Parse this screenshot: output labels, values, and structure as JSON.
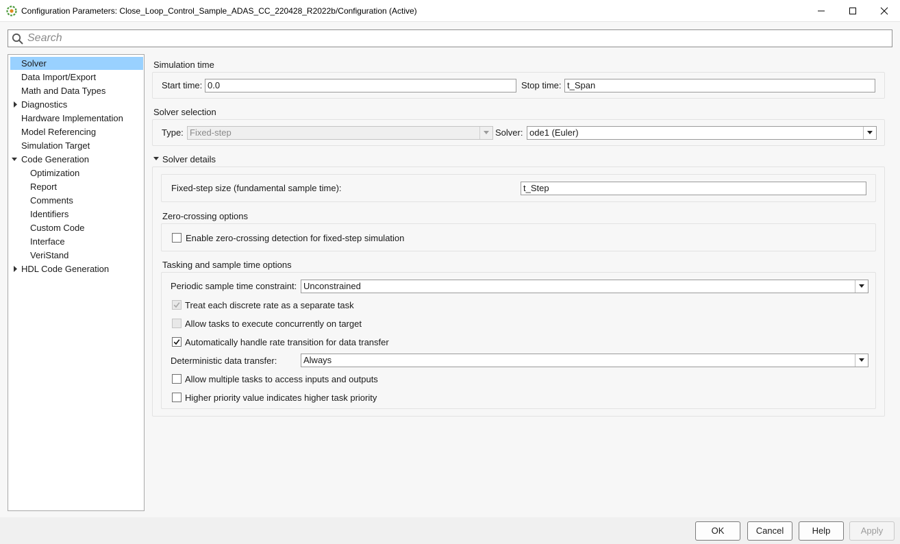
{
  "window": {
    "title": "Configuration Parameters: Close_Loop_Control_Sample_ADAS_CC_220428_R2022b/Configuration (Active)",
    "controls": [
      "minimize-icon",
      "maximize-icon",
      "close-icon"
    ]
  },
  "search": {
    "placeholder": "Search",
    "value": ""
  },
  "tree": {
    "items": [
      {
        "label": "Solver",
        "selected": true,
        "expandable": false
      },
      {
        "label": "Data Import/Export"
      },
      {
        "label": "Math and Data Types"
      },
      {
        "label": "Diagnostics",
        "expandable": true,
        "expanded": false
      },
      {
        "label": "Hardware Implementation"
      },
      {
        "label": "Model Referencing"
      },
      {
        "label": "Simulation Target"
      },
      {
        "label": "Code Generation",
        "expandable": true,
        "expanded": true
      },
      {
        "label": "Optimization",
        "child": true
      },
      {
        "label": "Report",
        "child": true
      },
      {
        "label": "Comments",
        "child": true
      },
      {
        "label": "Identifiers",
        "child": true
      },
      {
        "label": "Custom Code",
        "child": true
      },
      {
        "label": "Interface",
        "child": true
      },
      {
        "label": "VeriStand",
        "child": true
      },
      {
        "label": "HDL Code Generation",
        "expandable": true,
        "expanded": false
      }
    ]
  },
  "simulation_time": {
    "title": "Simulation time",
    "start_label": "Start time:",
    "start_value": "0.0",
    "stop_label": "Stop time:",
    "stop_value": "t_Span"
  },
  "solver_selection": {
    "title": "Solver selection",
    "type_label": "Type:",
    "type_value": "Fixed-step",
    "solver_label": "Solver:",
    "solver_value": "ode1 (Euler)"
  },
  "solver_details": {
    "title": "Solver details",
    "fixed_step_label": "Fixed-step size (fundamental sample time):",
    "fixed_step_value": "t_Step",
    "zero_crossing": {
      "title": "Zero-crossing options",
      "enable_label": "Enable zero-crossing detection for fixed-step simulation",
      "enable_checked": false
    },
    "tasking": {
      "title": "Tasking and sample time options",
      "periodic_label": "Periodic sample time constraint:",
      "periodic_value": "Unconstrained",
      "treat_label": "Treat each discrete rate as a separate task",
      "treat_checked": true,
      "allow_concurrent_label": "Allow tasks to execute concurrently on target",
      "allow_concurrent_checked": false,
      "auto_rate_label": "Automatically handle rate transition for data transfer",
      "auto_rate_checked": true,
      "deterministic_label": "Deterministic data transfer:",
      "deterministic_value": "Always",
      "allow_multiple_label": "Allow multiple tasks to access inputs and outputs",
      "allow_multiple_checked": false,
      "higher_priority_label": "Higher priority value indicates higher task priority",
      "higher_priority_checked": false
    }
  },
  "footer": {
    "ok_label": "OK",
    "cancel_label": "Cancel",
    "help_label": "Help",
    "apply_label": "Apply"
  },
  "colors": {
    "selection": "#99d1ff",
    "panel_bg": "#f7f7f7",
    "border": "#a8a8a8"
  }
}
